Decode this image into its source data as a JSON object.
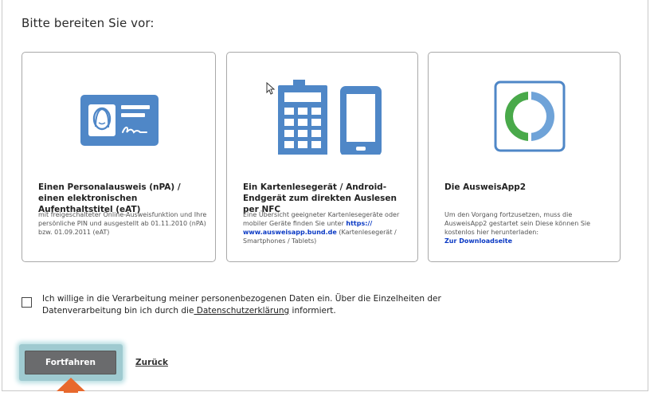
{
  "heading": "Bitte bereiten Sie vor:",
  "cards": [
    {
      "icon": "id-card-icon",
      "title": "Einen Personalausweis (nPA) / einen elektronischen Aufenthaltstitel (eAT)",
      "description": "mit freigeschalteter Online-Ausweisfunktion und Ihre persönliche PIN und ausgestellt ab 01.11.2010 (nPA) bzw. 01.09.2011 (eAT)"
    },
    {
      "icon": "card-reader-phone-icon",
      "title": "Ein Kartenlesegerät / Android-Endgerät zum direkten Auslesen per NFC",
      "description_before": "Eine Übersicht geeigneter Kartenlesegeräte oder mobiler Geräte finden Sie unter ",
      "link": "https:// www.ausweisapp.bund.de",
      "description_after": " (Kartenlesegerät / Smartphones / Tablets)"
    },
    {
      "icon": "ausweisapp-logo-icon",
      "title": "Die AusweisApp2",
      "description": "Um den Vorgang fortzusetzen, muss die AusweisApp2 gestartet sein Diese können Sie kostenlos hier herunterladen:",
      "link": "Zur Downloadseite"
    }
  ],
  "consent": {
    "text_before": "Ich willige in die Verarbeitung meiner personenbezogenen Daten ein. Über die Einzelheiten der Datenverarbeitung bin ich durch die",
    "link": " Datenschutzerklärung",
    "text_after": " informiert.",
    "checked": false
  },
  "buttons": {
    "continue": "Fortfahren",
    "back": "Zurück"
  },
  "colors": {
    "accent_blue": "#4f87c7",
    "link_blue": "#0a39c4",
    "button_gray": "#6a6b6d",
    "highlight_teal": "#9fcad0",
    "arrow_orange": "#e8692d",
    "logo_green": "#49a94a"
  }
}
